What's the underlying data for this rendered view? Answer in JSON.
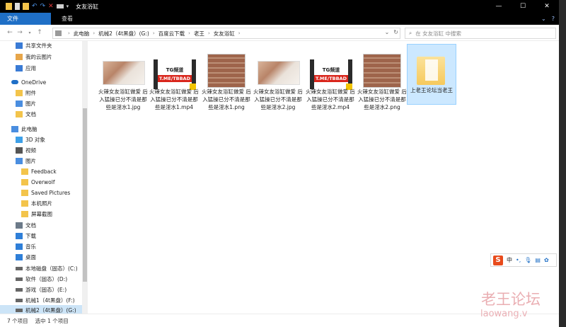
{
  "window": {
    "title": "女友浴缸"
  },
  "ribbon": {
    "tabs": [
      "文件",
      "主页",
      "共享",
      "查看"
    ]
  },
  "address": {
    "crumbs": [
      "此电脑",
      "机械2（4t黑盘）(G:)",
      "百度云下载",
      "老王",
      "女友浴缸"
    ],
    "search_placeholder": "在 女友浴缸 中搜索"
  },
  "nav": {
    "items": [
      {
        "label": "共享文件夹",
        "icon": "shared-folder-icon"
      },
      {
        "label": "我的云图片",
        "icon": "cloud-pictures-icon"
      },
      {
        "label": "应用",
        "icon": "apps-icon"
      },
      {
        "label": "OneDrive",
        "icon": "onedrive-icon"
      },
      {
        "label": "附件",
        "icon": "folder-icon"
      },
      {
        "label": "图片",
        "icon": "pictures-icon"
      },
      {
        "label": "文档",
        "icon": "folder-icon"
      },
      {
        "label": "此电脑",
        "icon": "pc-icon"
      },
      {
        "label": "3D 对象",
        "icon": "3d-objects-icon"
      },
      {
        "label": "视频",
        "icon": "videos-icon"
      },
      {
        "label": "图片",
        "icon": "pictures-icon"
      },
      {
        "label": "Feedback",
        "icon": "folder-icon"
      },
      {
        "label": "Overwolf",
        "icon": "folder-icon"
      },
      {
        "label": "Saved Pictures",
        "icon": "folder-icon"
      },
      {
        "label": "本机照片",
        "icon": "folder-icon"
      },
      {
        "label": "屏幕截图",
        "icon": "folder-icon"
      },
      {
        "label": "文档",
        "icon": "documents-icon"
      },
      {
        "label": "下载",
        "icon": "downloads-icon"
      },
      {
        "label": "音乐",
        "icon": "music-icon"
      },
      {
        "label": "桌面",
        "icon": "desktop-icon"
      },
      {
        "label": "本地磁盘（固态）(C:)",
        "icon": "drive-icon"
      },
      {
        "label": "软件（固态）(D:)",
        "icon": "drive-icon"
      },
      {
        "label": "游戏（固态）(E:)",
        "icon": "drive-icon"
      },
      {
        "label": "机械1（4t黑盘）(F:)",
        "icon": "drive-icon"
      },
      {
        "label": "机械2（4t黑盘）(G:)",
        "icon": "drive-icon"
      }
    ]
  },
  "files": [
    {
      "name": "火辣女友浴缸做爱 后入猛操已分不清是那些是淫水1.jpg",
      "kind": "photo"
    },
    {
      "name": "火辣女友浴缸做爱 后入猛操已分不清是那些是淫水1.mp4",
      "kind": "video",
      "line1": "TG频道",
      "line2": "T.ME/TBBAD"
    },
    {
      "name": "火辣女友浴缸做爱 后入猛操已分不清是那些是淫水1.png",
      "kind": "grid"
    },
    {
      "name": "火辣女友浴缸做爱 后入猛操已分不清是那些是淫水2.jpg",
      "kind": "photo"
    },
    {
      "name": "火辣女友浴缸做爱 后入猛操已分不清是那些是淫水2.mp4",
      "kind": "video",
      "line1": "TG频道",
      "line2": "T.ME/TBBAD"
    },
    {
      "name": "火辣女友浴缸做爱 后入猛操已分不清是那些是淫水2.png",
      "kind": "grid"
    },
    {
      "name": "上老王论坛当老王",
      "kind": "folder"
    }
  ],
  "status": {
    "count": "7 个项目",
    "selected": "选中 1 个项目"
  },
  "ime": {
    "lang": "中"
  },
  "watermark": {
    "text": "老王论坛",
    "url": "laowang.v"
  },
  "colors": {
    "accent": "#1f6fc6",
    "selection": "#cce8ff",
    "folder": "#f6c95c"
  }
}
